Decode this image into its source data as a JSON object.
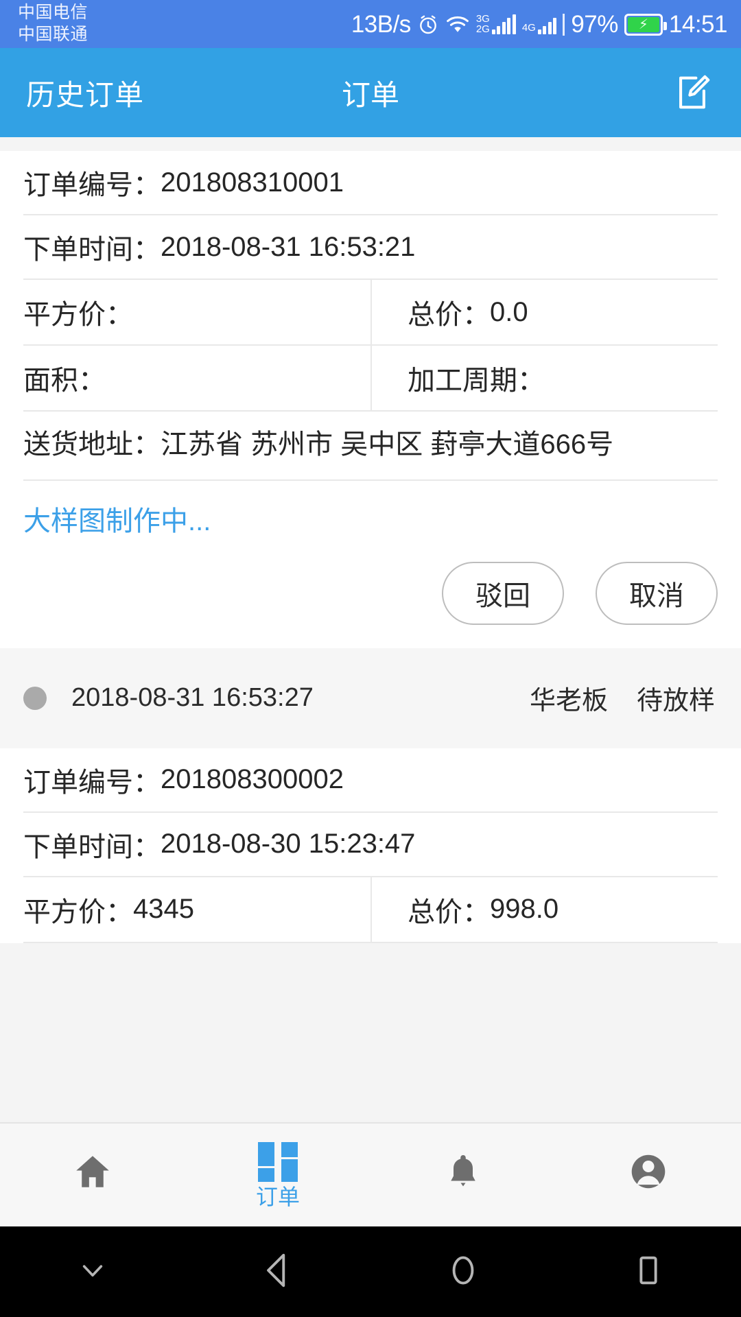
{
  "status_bar": {
    "carrier_1": "中国电信",
    "carrier_2": "中国联通",
    "net_speed": "13B/s",
    "alarm_icon": "alarm-clock-icon",
    "wifi_icon": "wifi-icon",
    "sim1_label_top": "3G",
    "sim1_label_bottom": "2G",
    "sim2_label": "4G",
    "battery_percent": "97%",
    "battery_state_icon": "battery-charging-icon",
    "clock": "14:51",
    "background_color": "#4a82e6"
  },
  "app_bar": {
    "back_label": "历史订单",
    "title": "订单",
    "edit_icon": "edit-pencil-icon",
    "background_color": "#32a1e4"
  },
  "orders": [
    {
      "order_no_label": "订单编号：",
      "order_no_value": "201808310001",
      "time_label": "下单时间：",
      "time_value": "2018-08-31 16:53:21",
      "unit_price_label": "平方价：",
      "unit_price_value": "",
      "total_price_label": "总价：",
      "total_price_value": "0.0",
      "area_label": "面积：",
      "area_value": "",
      "cycle_label": "加工周期：",
      "cycle_value": "",
      "address_label": "送货地址：",
      "address_value": "江苏省 苏州市 吴中区 葑亭大道666号",
      "drawing_link": "大样图制作中...",
      "drawing_link_color": "#3ca0e8",
      "buttons": [
        {
          "label": "驳回",
          "name": "reject-button"
        },
        {
          "label": "取消",
          "name": "cancel-button"
        }
      ],
      "status_strip": {
        "dot_color": "#aaaaaa",
        "time": "2018-08-31 16:53:27",
        "operator": "华老板",
        "state": "待放样"
      }
    },
    {
      "order_no_label": "订单编号：",
      "order_no_value": "201808300002",
      "time_label": "下单时间：",
      "time_value": "2018-08-30 15:23:47",
      "unit_price_label": "平方价：",
      "unit_price_value": "4345",
      "total_price_label": "总价：",
      "total_price_value": "998.0"
    }
  ],
  "tab_bar": {
    "tabs": [
      {
        "name": "tab-home",
        "icon": "home-icon",
        "label": "",
        "active": false
      },
      {
        "name": "tab-orders",
        "icon": "grid-icon",
        "label": "订单",
        "active": true
      },
      {
        "name": "tab-alerts",
        "icon": "bell-icon",
        "label": "",
        "active": false
      },
      {
        "name": "tab-profile",
        "icon": "person-icon",
        "label": "",
        "active": false
      }
    ],
    "active_color": "#3ca0e8",
    "inactive_color": "#6e6e6e"
  },
  "android_nav": {
    "keys": [
      {
        "name": "hide-keyboard-key",
        "icon": "chevron-down-icon"
      },
      {
        "name": "back-key",
        "icon": "triangle-back-icon"
      },
      {
        "name": "home-key",
        "icon": "circle-home-icon"
      },
      {
        "name": "recents-key",
        "icon": "square-recents-icon"
      }
    ]
  }
}
